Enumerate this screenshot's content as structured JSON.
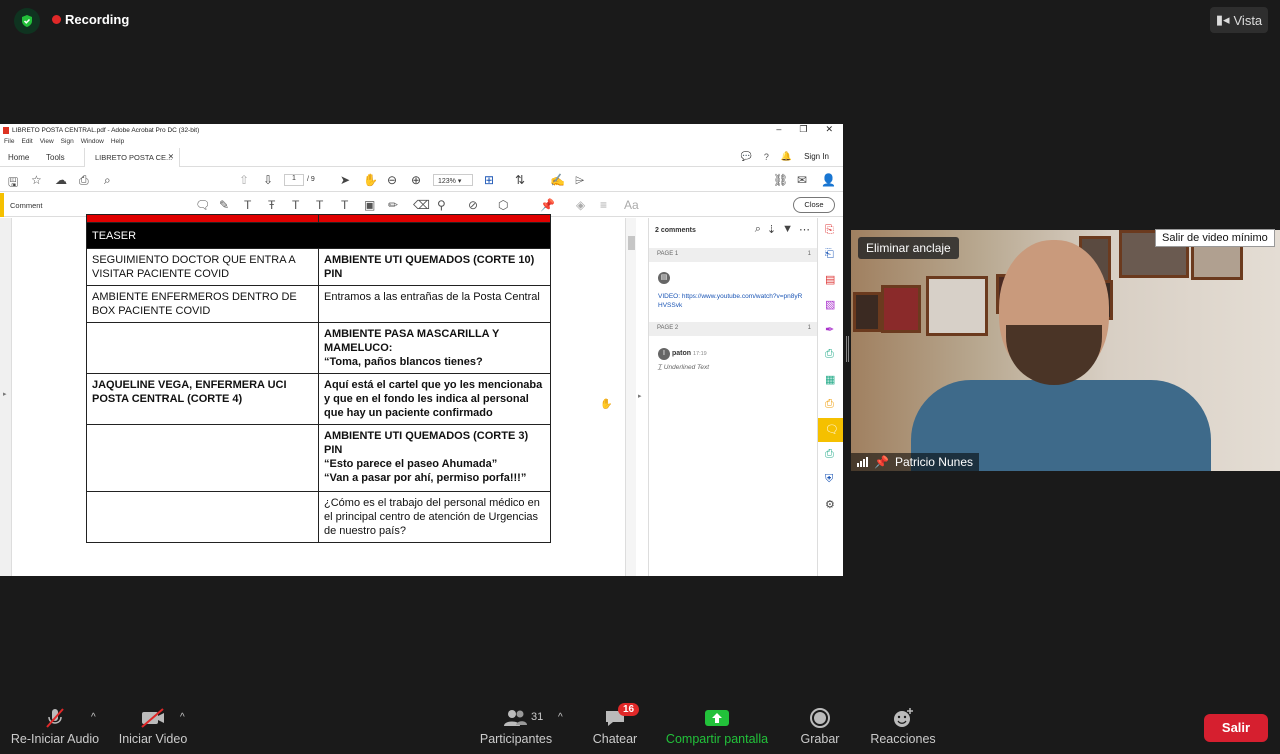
{
  "zoom": {
    "recording_label": "Recording",
    "view_label": "Vista",
    "unpin_label": "Eliminar anclaje",
    "min_video_label": "Salir de video mínimo",
    "participant_name": "Patricio Nunes",
    "participants_count": "31",
    "chat_badge": "16",
    "bottom": {
      "audio": "Re-Iniciar Audio",
      "video": "Iniciar Video",
      "participants": "Participantes",
      "chat": "Chatear",
      "share": "Compartir pantalla",
      "record": "Grabar",
      "reactions": "Reacciones",
      "leave": "Salir"
    }
  },
  "acrobat": {
    "window_title": "LIBRETO POSTA CENTRAL.pdf - Adobe Acrobat Pro DC (32-bit)",
    "menu": [
      "File",
      "Edit",
      "View",
      "Sign",
      "Window",
      "Help"
    ],
    "home_tab": "Home",
    "tools_tab": "Tools",
    "doc_tab": "LIBRETO POSTA CE...",
    "sign_in": "Sign In",
    "page_current": "1",
    "page_total": "/ 9",
    "zoom": "123%",
    "comment_label": "Comment",
    "close_label": "Close",
    "comments_header": "2 comments",
    "page1": "PAGE 1",
    "page2": "PAGE 2",
    "page_count1": "1",
    "page_count2": "1",
    "comment1_text": "VIDEO: https://www.youtube.com/watch?v=pn8yRHVSSvk",
    "comment2_author": "paton",
    "comment2_time": "17:19",
    "comment2_text": "Underlined Text"
  },
  "script": {
    "section": "TEASER",
    "rows": [
      {
        "left": "SEGUIMIENTO DOCTOR QUE ENTRA A VISITAR PACIENTE COVID",
        "right": "AMBIENTE UTI QUEMADOS (CORTE 10) PIN"
      },
      {
        "left": "AMBIENTE ENFERMEROS DENTRO DE BOX PACIENTE COVID",
        "right": "Entramos a las entrañas de la Posta Central"
      },
      {
        "left": "",
        "right": "AMBIENTE PASA MASCARILLA Y MAMELUCO:",
        "right2": "“Toma, paños blancos tienes?"
      },
      {
        "left": "JAQUELINE VEGA, ENFERMERA UCI POSTA CENTRAL (CORTE 4)",
        "right": "Aquí está el cartel que yo les mencionaba y que en el fondo les indica al personal que hay un paciente confirmado"
      },
      {
        "left": "",
        "right": "AMBIENTE UTI QUEMADOS (CORTE 3) PIN",
        "right2": "“Esto parece el paseo Ahumada”",
        "right3": "“Van a pasar por ahí, permiso porfa!!!”"
      },
      {
        "left": "",
        "right": "¿Cómo es el trabajo del personal médico en el principal centro de atención de Urgencias de nuestro país?"
      }
    ]
  }
}
